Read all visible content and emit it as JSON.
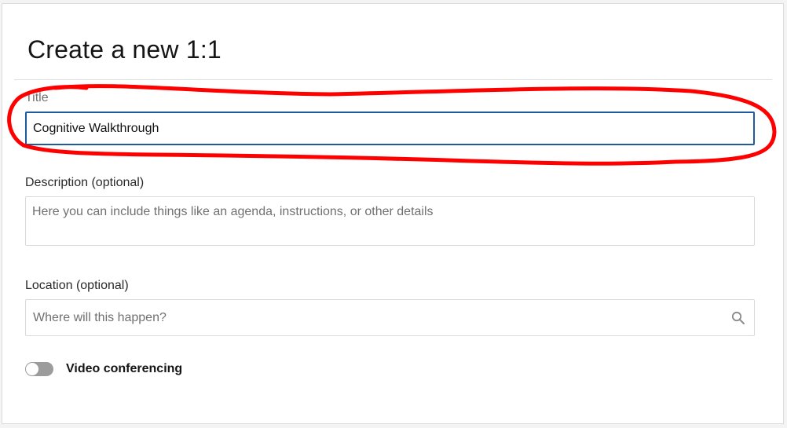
{
  "page_title": "Create a new 1:1",
  "fields": {
    "title": {
      "label": "Title",
      "value": "Cognitive Walkthrough"
    },
    "description": {
      "label": "Description (optional)",
      "placeholder": "Here you can include things like an agenda, instructions, or other details"
    },
    "location": {
      "label": "Location (optional)",
      "placeholder": "Where will this happen?",
      "icon": "search-icon"
    },
    "video_conferencing": {
      "label": "Video conferencing",
      "enabled": false
    }
  },
  "colors": {
    "focus_border": "#1f5a9e",
    "annotation": "#ff0000",
    "toggle_off": "#9c9c9c"
  }
}
